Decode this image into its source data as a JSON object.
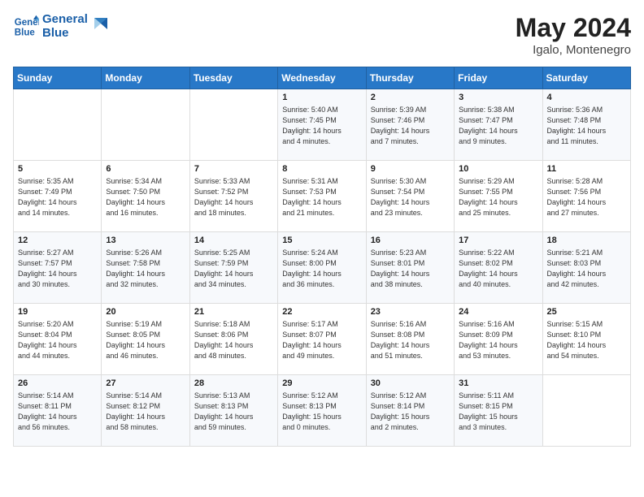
{
  "header": {
    "logo_line1": "General",
    "logo_line2": "Blue",
    "month": "May 2024",
    "location": "Igalo, Montenegro"
  },
  "weekdays": [
    "Sunday",
    "Monday",
    "Tuesday",
    "Wednesday",
    "Thursday",
    "Friday",
    "Saturday"
  ],
  "weeks": [
    [
      {
        "num": "",
        "info": ""
      },
      {
        "num": "",
        "info": ""
      },
      {
        "num": "",
        "info": ""
      },
      {
        "num": "1",
        "info": "Sunrise: 5:40 AM\nSunset: 7:45 PM\nDaylight: 14 hours\nand 4 minutes."
      },
      {
        "num": "2",
        "info": "Sunrise: 5:39 AM\nSunset: 7:46 PM\nDaylight: 14 hours\nand 7 minutes."
      },
      {
        "num": "3",
        "info": "Sunrise: 5:38 AM\nSunset: 7:47 PM\nDaylight: 14 hours\nand 9 minutes."
      },
      {
        "num": "4",
        "info": "Sunrise: 5:36 AM\nSunset: 7:48 PM\nDaylight: 14 hours\nand 11 minutes."
      }
    ],
    [
      {
        "num": "5",
        "info": "Sunrise: 5:35 AM\nSunset: 7:49 PM\nDaylight: 14 hours\nand 14 minutes."
      },
      {
        "num": "6",
        "info": "Sunrise: 5:34 AM\nSunset: 7:50 PM\nDaylight: 14 hours\nand 16 minutes."
      },
      {
        "num": "7",
        "info": "Sunrise: 5:33 AM\nSunset: 7:52 PM\nDaylight: 14 hours\nand 18 minutes."
      },
      {
        "num": "8",
        "info": "Sunrise: 5:31 AM\nSunset: 7:53 PM\nDaylight: 14 hours\nand 21 minutes."
      },
      {
        "num": "9",
        "info": "Sunrise: 5:30 AM\nSunset: 7:54 PM\nDaylight: 14 hours\nand 23 minutes."
      },
      {
        "num": "10",
        "info": "Sunrise: 5:29 AM\nSunset: 7:55 PM\nDaylight: 14 hours\nand 25 minutes."
      },
      {
        "num": "11",
        "info": "Sunrise: 5:28 AM\nSunset: 7:56 PM\nDaylight: 14 hours\nand 27 minutes."
      }
    ],
    [
      {
        "num": "12",
        "info": "Sunrise: 5:27 AM\nSunset: 7:57 PM\nDaylight: 14 hours\nand 30 minutes."
      },
      {
        "num": "13",
        "info": "Sunrise: 5:26 AM\nSunset: 7:58 PM\nDaylight: 14 hours\nand 32 minutes."
      },
      {
        "num": "14",
        "info": "Sunrise: 5:25 AM\nSunset: 7:59 PM\nDaylight: 14 hours\nand 34 minutes."
      },
      {
        "num": "15",
        "info": "Sunrise: 5:24 AM\nSunset: 8:00 PM\nDaylight: 14 hours\nand 36 minutes."
      },
      {
        "num": "16",
        "info": "Sunrise: 5:23 AM\nSunset: 8:01 PM\nDaylight: 14 hours\nand 38 minutes."
      },
      {
        "num": "17",
        "info": "Sunrise: 5:22 AM\nSunset: 8:02 PM\nDaylight: 14 hours\nand 40 minutes."
      },
      {
        "num": "18",
        "info": "Sunrise: 5:21 AM\nSunset: 8:03 PM\nDaylight: 14 hours\nand 42 minutes."
      }
    ],
    [
      {
        "num": "19",
        "info": "Sunrise: 5:20 AM\nSunset: 8:04 PM\nDaylight: 14 hours\nand 44 minutes."
      },
      {
        "num": "20",
        "info": "Sunrise: 5:19 AM\nSunset: 8:05 PM\nDaylight: 14 hours\nand 46 minutes."
      },
      {
        "num": "21",
        "info": "Sunrise: 5:18 AM\nSunset: 8:06 PM\nDaylight: 14 hours\nand 48 minutes."
      },
      {
        "num": "22",
        "info": "Sunrise: 5:17 AM\nSunset: 8:07 PM\nDaylight: 14 hours\nand 49 minutes."
      },
      {
        "num": "23",
        "info": "Sunrise: 5:16 AM\nSunset: 8:08 PM\nDaylight: 14 hours\nand 51 minutes."
      },
      {
        "num": "24",
        "info": "Sunrise: 5:16 AM\nSunset: 8:09 PM\nDaylight: 14 hours\nand 53 minutes."
      },
      {
        "num": "25",
        "info": "Sunrise: 5:15 AM\nSunset: 8:10 PM\nDaylight: 14 hours\nand 54 minutes."
      }
    ],
    [
      {
        "num": "26",
        "info": "Sunrise: 5:14 AM\nSunset: 8:11 PM\nDaylight: 14 hours\nand 56 minutes."
      },
      {
        "num": "27",
        "info": "Sunrise: 5:14 AM\nSunset: 8:12 PM\nDaylight: 14 hours\nand 58 minutes."
      },
      {
        "num": "28",
        "info": "Sunrise: 5:13 AM\nSunset: 8:13 PM\nDaylight: 14 hours\nand 59 minutes."
      },
      {
        "num": "29",
        "info": "Sunrise: 5:12 AM\nSunset: 8:13 PM\nDaylight: 15 hours\nand 0 minutes."
      },
      {
        "num": "30",
        "info": "Sunrise: 5:12 AM\nSunset: 8:14 PM\nDaylight: 15 hours\nand 2 minutes."
      },
      {
        "num": "31",
        "info": "Sunrise: 5:11 AM\nSunset: 8:15 PM\nDaylight: 15 hours\nand 3 minutes."
      },
      {
        "num": "",
        "info": ""
      }
    ]
  ]
}
